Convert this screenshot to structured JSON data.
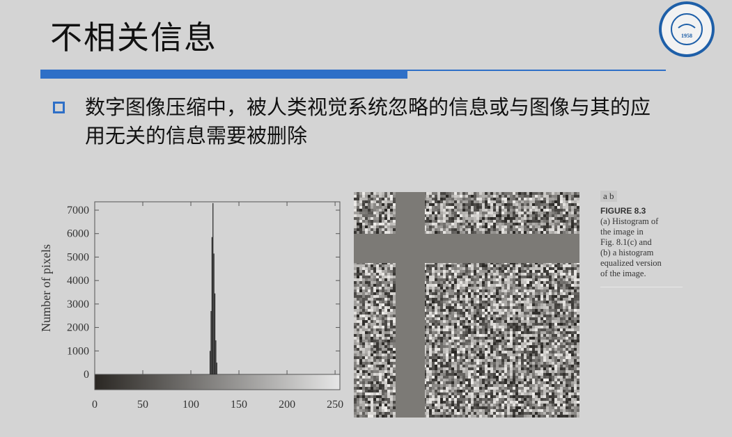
{
  "slide": {
    "title": "不相关信息",
    "bullet": "数字图像压缩中，被人类视觉系统忽略的信息或与图像与其的应用无关的信息需要被删除"
  },
  "logo": {
    "year": "1958"
  },
  "figure": {
    "panel_labels": "a b",
    "label": "FIGURE 8.3",
    "caption": "(a) Histogram of\nthe image in\nFig. 8.1(c) and\n(b) a histogram\nequalized version\nof the image."
  },
  "chart_data": {
    "type": "bar",
    "ylabel": "Number of pixels",
    "xlabel": "",
    "xlim": [
      0,
      255
    ],
    "ylim": [
      0,
      7000
    ],
    "xticks": [
      0,
      50,
      100,
      150,
      200,
      250
    ],
    "yticks": [
      0,
      1000,
      2000,
      3000,
      4000,
      5000,
      6000,
      7000
    ],
    "x": [
      120,
      121,
      122,
      123,
      124,
      125,
      126,
      127
    ],
    "values": [
      1000,
      2700,
      5850,
      7300,
      5150,
      3450,
      1450,
      500
    ],
    "grid": false,
    "colorbar": "grayscale gradient below x-axis"
  },
  "image_panel": {
    "type": "noise-image",
    "colors": {
      "bar": "#7c7a76"
    }
  }
}
